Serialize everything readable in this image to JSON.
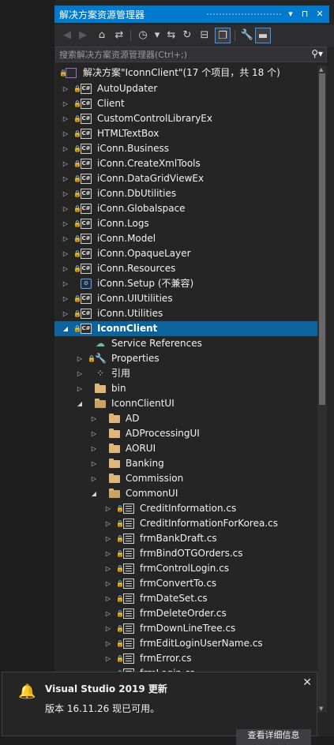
{
  "window": {
    "title": "解决方案资源管理器"
  },
  "search": {
    "placeholder": "搜索解决方案资源管理器(Ctrl+;)"
  },
  "tree": {
    "solution": "解决方案\"IconnClient\"(17 个项目，共 18 个)",
    "projects": [
      "AutoUpdater",
      "Client",
      "CustomControlLibraryEx",
      "HTMLTextBox",
      "iConn.Business",
      "iConn.CreateXmlTools",
      "iConn.DataGridViewEx",
      "iConn.DbUtilities",
      "iConn.Globalspace",
      "iConn.Logs",
      "iConn.Model",
      "iConn.OpaqueLayer",
      "iConn.Resources",
      "iConn.Setup (不兼容)",
      "iConn.UIUtilities",
      "iConn.Utilities",
      "IconnClient"
    ],
    "client_children": [
      "Service References",
      "Properties",
      "引用",
      "bin",
      "IconnClientUI"
    ],
    "ui_folders": [
      "AD",
      "ADProcessingUI",
      "AORUI",
      "Banking",
      "Commission",
      "CommonUI"
    ],
    "common_files": [
      "CreditInformation.cs",
      "CreditInformationForKorea.cs",
      "frmBankDraft.cs",
      "frmBindOTGOrders.cs",
      "frmControlLogin.cs",
      "frmConvertTo.cs",
      "frmDateSet.cs",
      "frmDeleteOrder.cs",
      "frmDownLineTree.cs",
      "frmEditLoginUserName.cs",
      "frmError.cs",
      "frmLogin.cs"
    ]
  },
  "notification": {
    "title": "Visual Studio 2019 更新",
    "body": "版本 16.11.26 现已可用。",
    "button": "查看详细信息"
  },
  "colors": {
    "accent": "#007acc",
    "selected": "#0e639c",
    "background": "#252526"
  }
}
